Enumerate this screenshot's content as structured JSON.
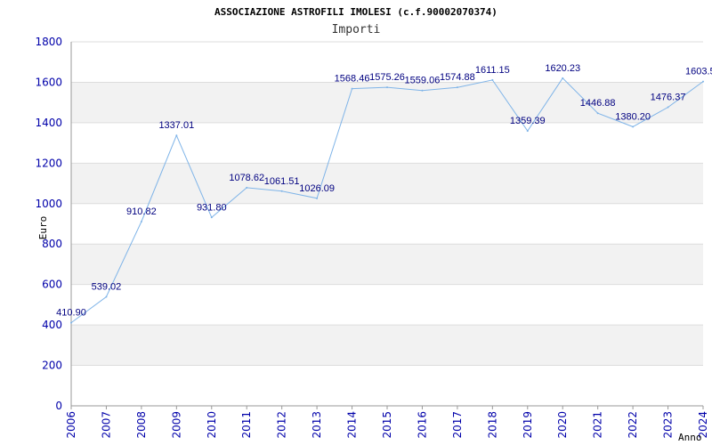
{
  "chart_data": {
    "type": "line",
    "title": "ASSOCIAZIONE ASTROFILI IMOLESI (c.f.90002070374)",
    "subtitle": "Importi",
    "xlabel": "Anno",
    "ylabel": "Euro",
    "ylim": [
      0,
      1800
    ],
    "yticks": [
      0,
      200,
      400,
      600,
      800,
      1000,
      1200,
      1400,
      1600,
      1800
    ],
    "x": [
      "2006",
      "2007",
      "2008",
      "2009",
      "2010",
      "2011",
      "2012",
      "2013",
      "2014",
      "2015",
      "2016",
      "2017",
      "2018",
      "2019",
      "2020",
      "2021",
      "2022",
      "2023",
      "2024"
    ],
    "values": [
      410.9,
      539.02,
      910.82,
      1337.01,
      931.8,
      1078.62,
      1061.51,
      1026.09,
      1568.46,
      1575.26,
      1559.06,
      1574.88,
      1611.15,
      1359.39,
      1620.23,
      1446.88,
      1380.2,
      1476.37,
      1603.5
    ],
    "data_labels": [
      "410.90",
      "539.02",
      "910.82",
      "1337.01",
      "931.80",
      "1078.62",
      "1061.51",
      "1026.09",
      "1568.46",
      "1575.26",
      "1559.06",
      "1574.88",
      "1611.15",
      "1359.39",
      "1620.23",
      "1446.88",
      "1380.20",
      "1476.37",
      "1603.5"
    ],
    "grid": true,
    "line_color": "#7fb4e8",
    "band_color": "#f2f2f2",
    "grid_color": "#dddddd",
    "tick_color": "#0000aa",
    "label_color": "#000080"
  }
}
